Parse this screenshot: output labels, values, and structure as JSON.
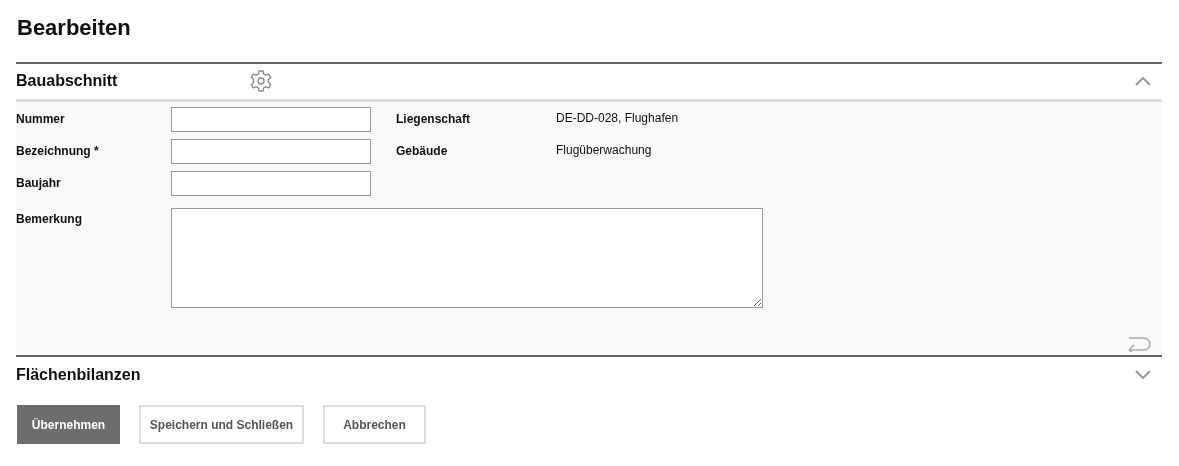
{
  "title": "Bearbeiten",
  "sections": [
    {
      "title": "Bauabschnitt",
      "expanded": true,
      "has_settings": true,
      "fields": [
        {
          "label": "Nummer"
        },
        {
          "label": "Bezeichnung *"
        },
        {
          "label": "Baujahr"
        }
      ],
      "info": [
        {
          "label": "Liegenschaft",
          "value": "DE-DD-028, Flughafen"
        },
        {
          "label": "Gebäude",
          "value": "Flugüberwachung"
        }
      ],
      "remark": {
        "label": "Bemerkung"
      }
    },
    {
      "title": "Flächenbilanzen",
      "expanded": false,
      "has_settings": false
    }
  ],
  "buttons": [
    {
      "label": "Übernehmen",
      "kind": "primary"
    },
    {
      "label": "Speichern und Schließen",
      "kind": "secondary"
    },
    {
      "label": "Abbrechen",
      "kind": "secondary"
    }
  ]
}
